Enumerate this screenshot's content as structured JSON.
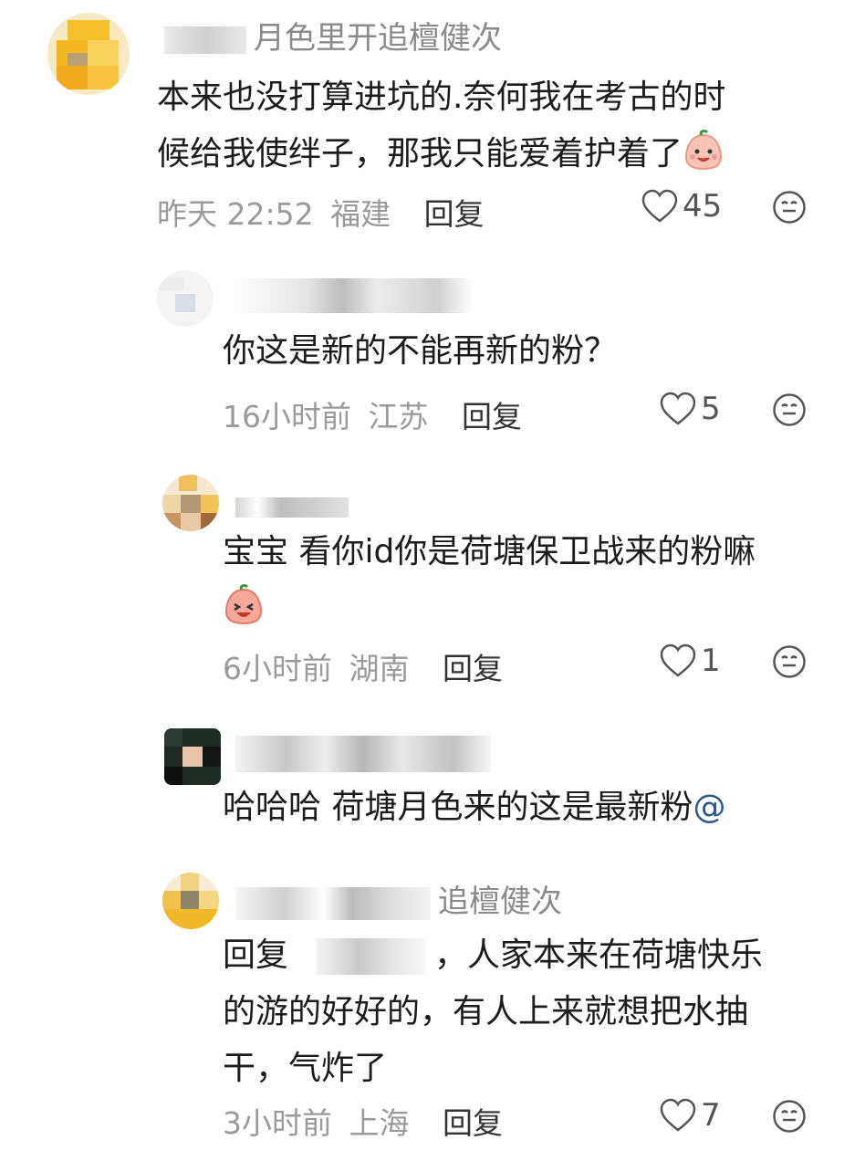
{
  "comments": [
    {
      "name_visible": "月色里开追檀健次",
      "text_lines": [
        "本来也没打算进坑的.奈何我在考古的时",
        "候给我使绊子，那我只能爱着护着了"
      ],
      "emoji": "laugh-peach",
      "time": "昨天 22:52",
      "location": "福建",
      "reply_label": "回复",
      "likes": "45"
    },
    {
      "name_visible": "",
      "text_lines": [
        "你这是新的不能再新的粉？"
      ],
      "time": "16小时前",
      "location": "江苏",
      "reply_label": "回复",
      "likes": "5"
    },
    {
      "name_visible": "",
      "text_lines": [
        "宝宝 看你id你是荷塘保卫战来的粉嘛"
      ],
      "emoji": "laugh-peach",
      "time": "6小时前",
      "location": "湖南",
      "reply_label": "回复",
      "likes": "1"
    },
    {
      "name_visible": "",
      "text_lines": [
        "哈哈哈 荷塘月色来的这是最新粉"
      ],
      "mention": "@",
      "time": "",
      "location": "",
      "reply_label": "",
      "likes": ""
    },
    {
      "name_visible": "追檀健次",
      "reply_prefix": "回复",
      "reply_suffix": "，人家本来在荷塘快乐",
      "text_lines": [
        "的游的好好的，有人上来就想把水抽",
        "干，气炸了"
      ],
      "time": "3小时前",
      "location": "上海",
      "reply_label": "回复",
      "likes": "7"
    }
  ],
  "colors": {
    "text": "#1c1c1c",
    "meta": "#9a9a9a",
    "mention": "#2b5a8a"
  },
  "icons": [
    "heart-icon",
    "smile-face-icon",
    "peach-emoji"
  ]
}
